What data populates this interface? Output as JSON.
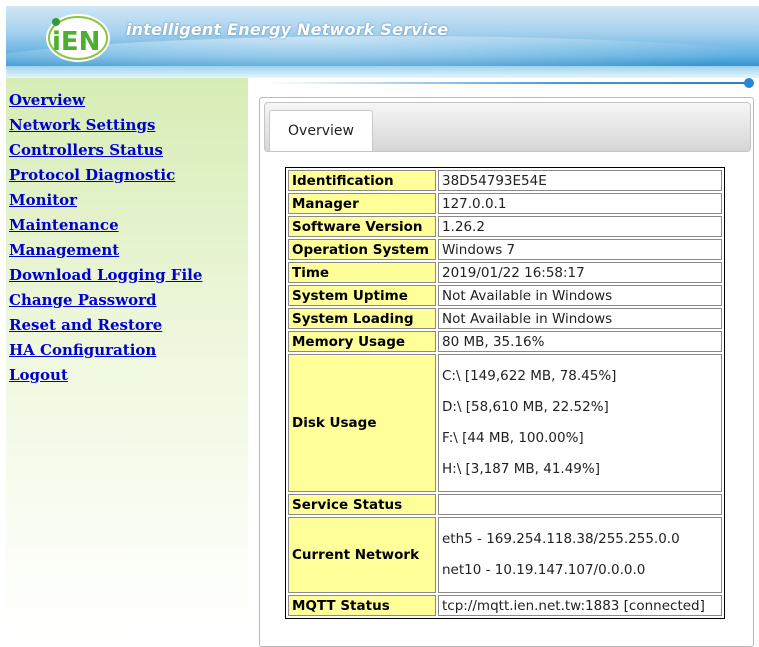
{
  "header": {
    "title": "intelligent Energy Network Service",
    "logo_text": "iEN"
  },
  "sidebar": {
    "items": [
      {
        "label": "Overview"
      },
      {
        "label": "Network Settings"
      },
      {
        "label": "Controllers Status"
      },
      {
        "label": "Protocol Diagnostic"
      },
      {
        "label": "Monitor"
      },
      {
        "label": "Maintenance"
      },
      {
        "label": "Management"
      },
      {
        "label": "Download Logging File"
      },
      {
        "label": "Change Password"
      },
      {
        "label": "Reset and Restore"
      },
      {
        "label": "HA Configuration"
      },
      {
        "label": "Logout"
      }
    ]
  },
  "main": {
    "tab": "Overview",
    "rows": {
      "identification": {
        "label": "Identification",
        "value": "38D54793E54E"
      },
      "manager": {
        "label": "Manager",
        "value": "127.0.0.1"
      },
      "software_version": {
        "label": "Software Version",
        "value": "1.26.2"
      },
      "os": {
        "label": "Operation System",
        "value": "Windows 7"
      },
      "time": {
        "label": "Time",
        "value": "2019/01/22 16:58:17"
      },
      "uptime": {
        "label": "System Uptime",
        "value": "Not Available in Windows"
      },
      "loading": {
        "label": "System Loading",
        "value": "Not Available in Windows"
      },
      "memory": {
        "label": "Memory Usage",
        "value": "80 MB, 35.16%"
      },
      "disk": {
        "label": "Disk Usage",
        "values": [
          "C:\\ [149,622 MB, 78.45%]",
          "D:\\ [58,610 MB, 22.52%]",
          "F:\\ [44 MB, 100.00%]",
          "H:\\ [3,187 MB, 41.49%]"
        ]
      },
      "service": {
        "label": "Service Status",
        "value": ""
      },
      "network": {
        "label": "Current Network",
        "values": [
          "eth5 - 169.254.118.38/255.255.0.0",
          "net10 - 10.19.147.107/0.0.0.0"
        ]
      },
      "mqtt": {
        "label": "MQTT Status",
        "value": "tcp://mqtt.ien.net.tw:1883 [connected]"
      }
    }
  },
  "colors": {
    "link": "#0000cc",
    "key_cell": "#ffff99",
    "banner": "#5fb0e0",
    "sidebar": "#d7edb6"
  }
}
